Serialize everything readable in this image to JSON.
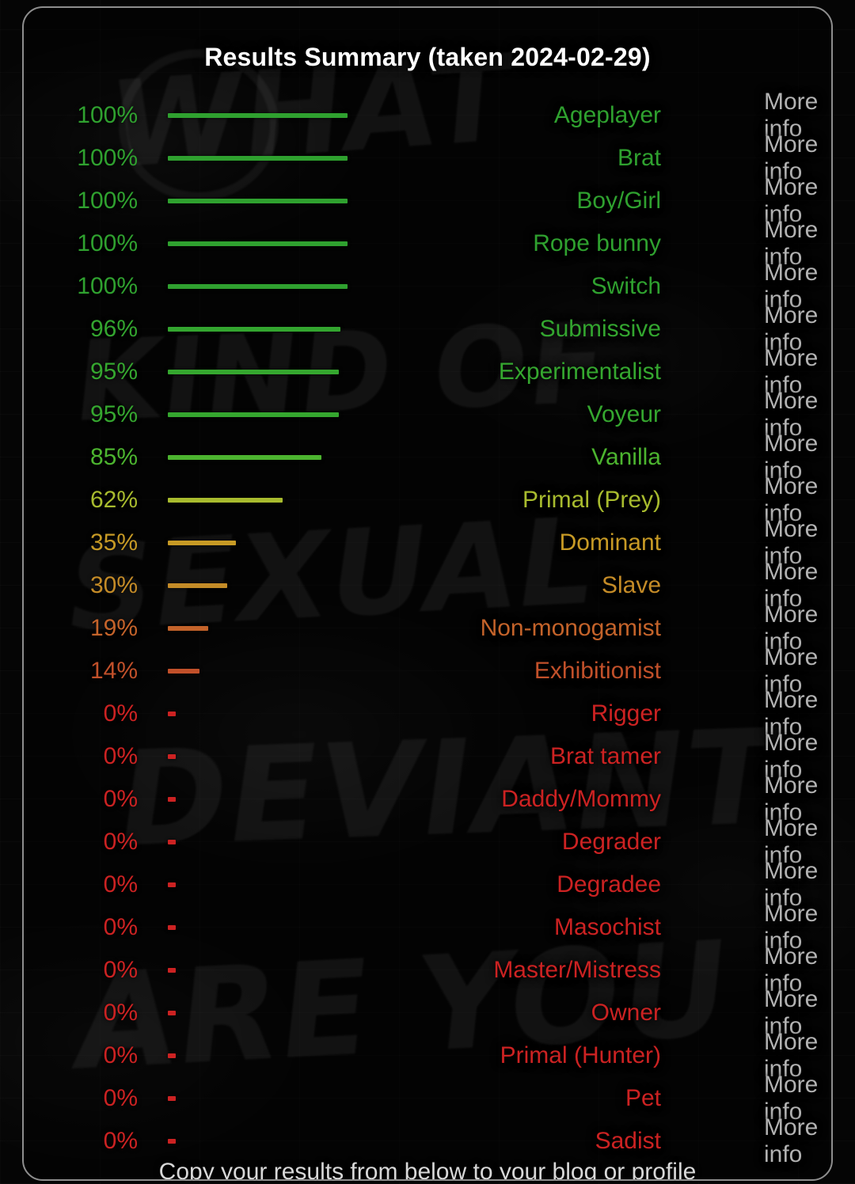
{
  "card": {
    "title": "Results Summary (taken 2024-02-29)",
    "more_info_label": "More info",
    "footer_note": "Copy your results from below to your blog or profile"
  },
  "graffiti": {
    "word1": "WHAT",
    "word2": "KIND OF",
    "word3": "SEXUAL",
    "word4": "DEVIANT",
    "word5": "ARE YOU"
  },
  "colors": {
    "green": "#2fa12f",
    "green_light": "#5bb92f",
    "yellow_green": "#a8bb2e",
    "yellow": "#c79a25",
    "orange": "#c4632a",
    "orange_red": "#c1502a",
    "red": "#cc2222",
    "more_info": "#b2b2b2",
    "title": "#ffffff",
    "card_border": "#8e8e8e"
  },
  "chart_data": {
    "type": "bar",
    "title": "Results Summary (taken 2024-02-29)",
    "xlabel": "",
    "ylabel": "",
    "xlim": [
      0,
      100
    ],
    "grid": false,
    "legend": "none",
    "orientation": "horizontal",
    "categories": [
      "Ageplayer",
      "Brat",
      "Boy/Girl",
      "Rope bunny",
      "Switch",
      "Submissive",
      "Experimentalist",
      "Voyeur",
      "Vanilla",
      "Primal (Prey)",
      "Dominant",
      "Slave",
      "Non-monogamist",
      "Exhibitionist",
      "Rigger",
      "Brat tamer",
      "Daddy/Mommy",
      "Degrader",
      "Degradee",
      "Masochist",
      "Master/Mistress",
      "Owner",
      "Primal (Hunter)",
      "Pet",
      "Sadist"
    ],
    "values": [
      100,
      100,
      100,
      100,
      100,
      96,
      95,
      95,
      85,
      62,
      35,
      30,
      19,
      14,
      0,
      0,
      0,
      0,
      0,
      0,
      0,
      0,
      0,
      0,
      0
    ],
    "value_labels": [
      "100%",
      "100%",
      "100%",
      "100%",
      "100%",
      "96%",
      "95%",
      "95%",
      "85%",
      "62%",
      "35%",
      "30%",
      "19%",
      "14%",
      "0%",
      "0%",
      "0%",
      "0%",
      "0%",
      "0%",
      "0%",
      "0%",
      "0%",
      "0%",
      "0%"
    ]
  },
  "rows": [
    {
      "pct": "100%",
      "label": "Ageplayer",
      "value": 100,
      "color": "#2fa12f"
    },
    {
      "pct": "100%",
      "label": "Brat",
      "value": 100,
      "color": "#2fa12f"
    },
    {
      "pct": "100%",
      "label": "Boy/Girl",
      "value": 100,
      "color": "#2fa12f"
    },
    {
      "pct": "100%",
      "label": "Rope bunny",
      "value": 100,
      "color": "#2fa12f"
    },
    {
      "pct": "100%",
      "label": "Switch",
      "value": 100,
      "color": "#2fa12f"
    },
    {
      "pct": "96%",
      "label": "Submissive",
      "value": 96,
      "color": "#33a52f"
    },
    {
      "pct": "95%",
      "label": "Experimentalist",
      "value": 95,
      "color": "#35a72f"
    },
    {
      "pct": "95%",
      "label": "Voyeur",
      "value": 95,
      "color": "#35a72f"
    },
    {
      "pct": "85%",
      "label": "Vanilla",
      "value": 85,
      "color": "#4cb42f"
    },
    {
      "pct": "62%",
      "label": "Primal (Prey)",
      "value": 62,
      "color": "#a8bb2e"
    },
    {
      "pct": "35%",
      "label": "Dominant",
      "value": 35,
      "color": "#c79a25"
    },
    {
      "pct": "30%",
      "label": "Slave",
      "value": 30,
      "color": "#c48b27"
    },
    {
      "pct": "19%",
      "label": "Non-monogamist",
      "value": 19,
      "color": "#c4632a"
    },
    {
      "pct": "14%",
      "label": "Exhibitionist",
      "value": 14,
      "color": "#c1502a"
    },
    {
      "pct": "0%",
      "label": "Rigger",
      "value": 0,
      "color": "#cc2222"
    },
    {
      "pct": "0%",
      "label": "Brat tamer",
      "value": 0,
      "color": "#cc2222"
    },
    {
      "pct": "0%",
      "label": "Daddy/Mommy",
      "value": 0,
      "color": "#cc2222"
    },
    {
      "pct": "0%",
      "label": "Degrader",
      "value": 0,
      "color": "#cc2222"
    },
    {
      "pct": "0%",
      "label": "Degradee",
      "value": 0,
      "color": "#cc2222"
    },
    {
      "pct": "0%",
      "label": "Masochist",
      "value": 0,
      "color": "#cc2222"
    },
    {
      "pct": "0%",
      "label": "Master/Mistress",
      "value": 0,
      "color": "#cc2222"
    },
    {
      "pct": "0%",
      "label": "Owner",
      "value": 0,
      "color": "#cc2222"
    },
    {
      "pct": "0%",
      "label": "Primal (Hunter)",
      "value": 0,
      "color": "#cc2222"
    },
    {
      "pct": "0%",
      "label": "Pet",
      "value": 0,
      "color": "#cc2222"
    },
    {
      "pct": "0%",
      "label": "Sadist",
      "value": 0,
      "color": "#cc2222"
    }
  ]
}
